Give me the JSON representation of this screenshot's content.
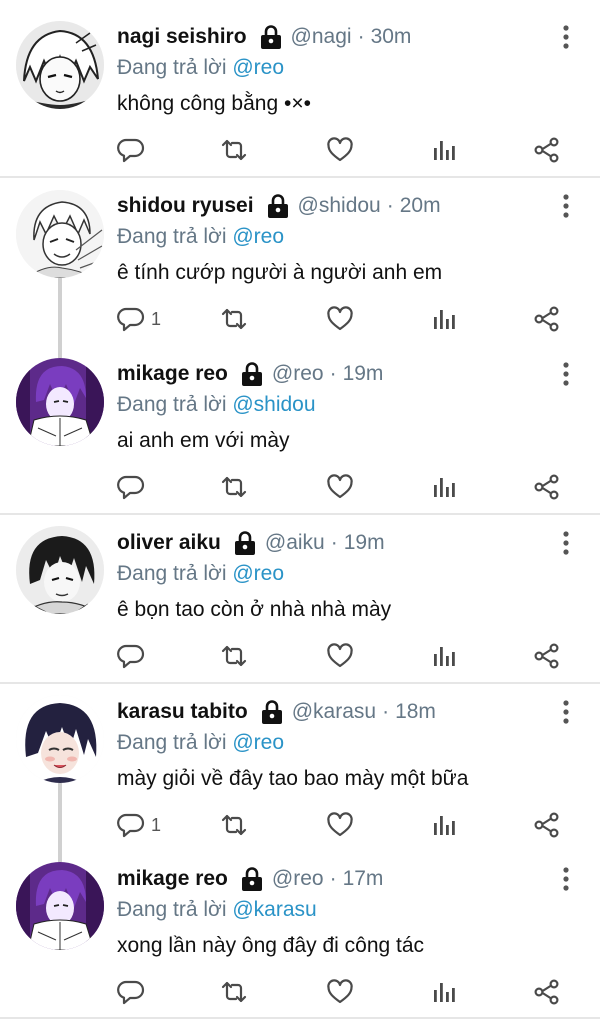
{
  "reply_prefix": "Đang trả lời",
  "actions": {
    "reply_icon": "reply-icon",
    "retweet_icon": "retweet-icon",
    "like_icon": "heart-icon",
    "stats_icon": "stats-icon",
    "share_icon": "share-icon"
  },
  "colors": {
    "mention": "#2a93c7",
    "meta": "#657786",
    "divider": "#e6e6e6"
  },
  "tweets": [
    {
      "name": "nagi seishiro",
      "handle": "@nagi",
      "sep": "·",
      "time": "30m",
      "reply_to": "@reo",
      "text": "không công bằng •×•",
      "reply_count": "",
      "avatar": "white-hair-character"
    },
    {
      "name": "shidou ryusei",
      "handle": "@shidou",
      "sep": "·",
      "time": "20m",
      "reply_to": "@reo",
      "text": "ê tính cướp người à người anh em",
      "reply_count": "1",
      "avatar": "sketch-character"
    },
    {
      "name": "mikage reo",
      "handle": "@reo",
      "sep": "·",
      "time": "19m",
      "reply_to": "@shidou",
      "text": "ai anh em với mày",
      "reply_count": "",
      "avatar": "purple-hair-character"
    },
    {
      "name": "oliver aiku",
      "handle": "@aiku",
      "sep": "·",
      "time": "19m",
      "reply_to": "@reo",
      "text": "ê bọn tao còn ở nhà nhà mày",
      "reply_count": "",
      "avatar": "dark-hair-character"
    },
    {
      "name": "karasu tabito",
      "handle": "@karasu",
      "sep": "·",
      "time": "18m",
      "reply_to": "@reo",
      "text": "mày giỏi về đây tao bao mày một bữa",
      "reply_count": "1",
      "avatar": "navy-hair-character"
    },
    {
      "name": "mikage reo",
      "handle": "@reo",
      "sep": "·",
      "time": "17m",
      "reply_to": "@karasu",
      "text": "xong lần này ông đây đi công tác",
      "reply_count": "",
      "avatar": "purple-hair-character"
    }
  ]
}
